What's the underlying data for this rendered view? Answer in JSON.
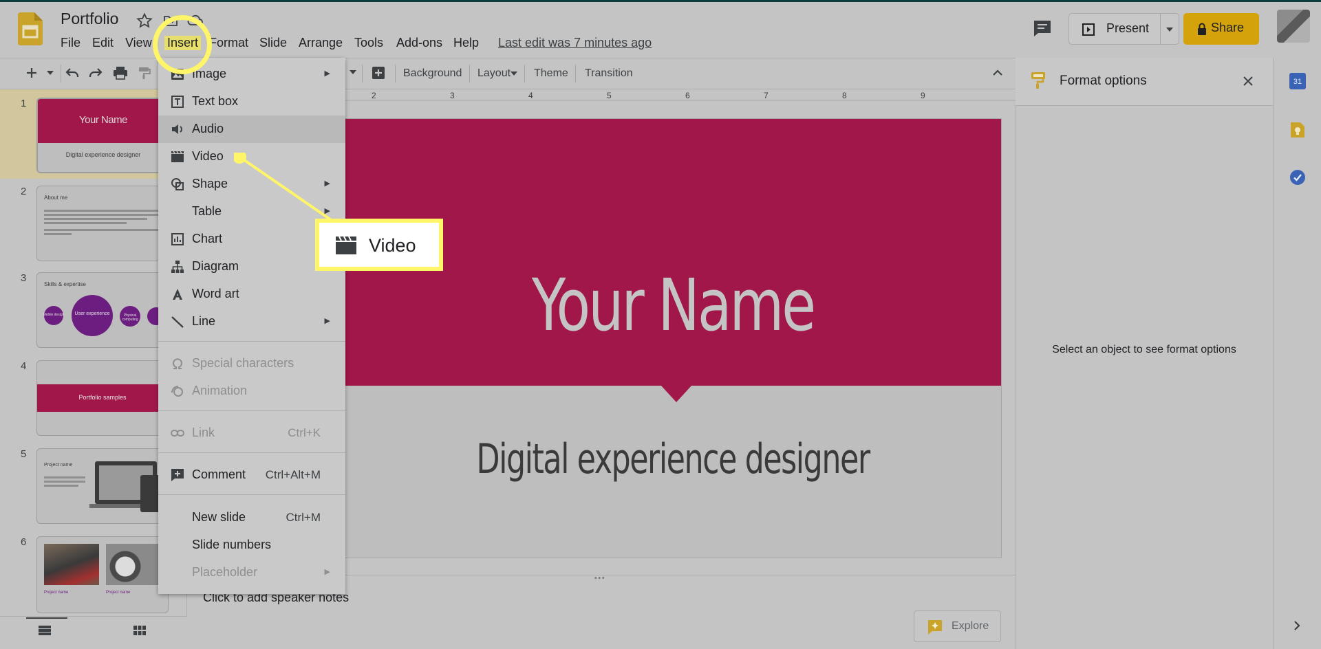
{
  "app": {
    "title": "Portfolio",
    "menu": [
      "File",
      "Edit",
      "View",
      "Insert",
      "Format",
      "Slide",
      "Arrange",
      "Tools",
      "Add-ons",
      "Help"
    ],
    "last_edit": "Last edit was 7 minutes ago",
    "present_label": "Present",
    "share_label": "Share"
  },
  "toolbar": {
    "background_label": "Background",
    "layout_label": "Layout",
    "theme_label": "Theme",
    "transition_label": "Transition"
  },
  "ruler": {
    "ticks": [
      "2",
      "3",
      "4",
      "5",
      "6",
      "7",
      "8",
      "9"
    ]
  },
  "filmstrip": {
    "slides": [
      {
        "number": "1",
        "title": "Your Name",
        "subtitle": "Digital experience designer"
      },
      {
        "number": "2",
        "title": "About me"
      },
      {
        "number": "3",
        "title": "Skills & expertise",
        "bubbles": [
          "Mobile design",
          "User experience",
          "Physical computing"
        ]
      },
      {
        "number": "4",
        "title": "Portfolio samples"
      },
      {
        "number": "5",
        "title": "Project name"
      },
      {
        "number": "6",
        "captions": [
          "Project name",
          "Project name"
        ]
      }
    ]
  },
  "insert_menu": {
    "items": [
      {
        "label": "Image",
        "icon": "image-icon",
        "submenu": true
      },
      {
        "label": "Text box",
        "icon": "text-box-icon"
      },
      {
        "label": "Audio",
        "icon": "audio-icon",
        "highlighted": true
      },
      {
        "label": "Video",
        "icon": "video-icon"
      },
      {
        "label": "Shape",
        "icon": "shape-icon",
        "submenu": true
      },
      {
        "label": "Table",
        "icon": "",
        "submenu": true
      },
      {
        "label": "Chart",
        "icon": "chart-icon",
        "submenu": true
      },
      {
        "label": "Diagram",
        "icon": "diagram-icon"
      },
      {
        "label": "Word art",
        "icon": "word-art-icon"
      },
      {
        "label": "Line",
        "icon": "line-icon",
        "submenu": true
      },
      {
        "label": "Special characters",
        "icon": "omega-icon",
        "disabled": true
      },
      {
        "label": "Animation",
        "icon": "animation-icon",
        "disabled": true
      },
      {
        "label": "Link",
        "icon": "link-icon",
        "shortcut": "Ctrl+K",
        "disabled": true
      },
      {
        "label": "Comment",
        "icon": "add-comment-icon",
        "shortcut": "Ctrl+Alt+M"
      },
      {
        "label": "New slide",
        "icon": "",
        "shortcut": "Ctrl+M"
      },
      {
        "label": "Slide numbers",
        "icon": ""
      },
      {
        "label": "Placeholder",
        "icon": "",
        "submenu": true,
        "disabled": true
      }
    ]
  },
  "callout": {
    "label": "Video",
    "icon": "video-icon",
    "highlighted_menu": "Insert"
  },
  "slide": {
    "title": "Your Name",
    "subtitle": "Digital experience designer",
    "accent_color": "#a2174a"
  },
  "notes": {
    "placeholder": "Click to add speaker notes"
  },
  "format_panel": {
    "title": "Format options",
    "message": "Select an object to see format options"
  },
  "explore": {
    "label": "Explore"
  },
  "right_rail": {
    "calendar_label": "31"
  },
  "colors": {
    "brand_yellow": "#d4a20a",
    "highlight_yellow": "#fff568",
    "slide_accent": "#a2174a"
  }
}
